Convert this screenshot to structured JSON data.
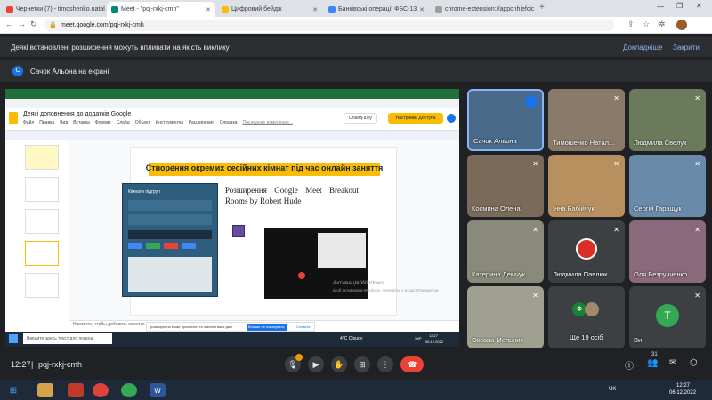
{
  "browser": {
    "tabs": [
      {
        "label": "Чернетки (7) - timoshenko.natal",
        "color": "#ea4335"
      },
      {
        "label": "Meet - \"pqj-rxkj-cmh\"",
        "color": "#00897b"
      },
      {
        "label": "Цифровий бейдж",
        "color": "#fbbc04"
      },
      {
        "label": "Банківські операції ФБС-13",
        "color": "#4285f4"
      },
      {
        "label": "chrome-extension://appcnhiefcic",
        "color": "#9e9e9e"
      }
    ],
    "url": "meet.google.com/pqj-rxkj-cmh"
  },
  "warning": {
    "text": "Деякі встановлені розширення можуть впливати на якість виклику",
    "details": "Докладніше",
    "close": "Закрити"
  },
  "presenter_bar": {
    "initial": "С",
    "text": "Сачок Альона на екрані"
  },
  "shared_screen": {
    "doc_title": "Деякі доповнення до додатків Google",
    "menu": [
      "Файл",
      "Правка",
      "Вид",
      "Вставка",
      "Формат",
      "Слайд",
      "Объект",
      "Инструменты",
      "Расширения",
      "Справка",
      "Последнее изменение..."
    ],
    "slideshow_btn": "Слайд-шоу",
    "access_btn": "Настройки Доступа",
    "slide_heading": "Створення окремих сесійних кімнат під час онлайн заняття",
    "slide_text": "Розширення Google Meet Breakout Rooms by Robert Hude",
    "panel_title": "Кімнати підгруп",
    "notes": "Нажмите, чтобы добавить заметки докладчика",
    "popup_text": "розширення може прочитати та змінити ваші дані",
    "popup_btn": "Більше не показувати",
    "popup_btn2": "Сховати",
    "activation1": "Активація Windows",
    "activation2": "Щоб активувати Windows, перейдіть у розділ Параметри.",
    "search": "Введите здесь текст для поиска",
    "weather": "4°C Cloudy",
    "inner_lang": "УКР",
    "inner_time": "12:27",
    "inner_date": "06.12.2022"
  },
  "participants": [
    {
      "name": "Сачок Альона",
      "bg": "#4a6a8a",
      "speaking": true
    },
    {
      "name": "Тимошенко Натал...",
      "bg": "#8a7a6a"
    },
    {
      "name": "Людмила Свелук",
      "bg": "#6a7a5a"
    },
    {
      "name": "Космина Олена",
      "bg": "#7a6a5a"
    },
    {
      "name": "Інна Бабійчук",
      "bg": "#b89060"
    },
    {
      "name": "Сергій Гаращук",
      "bg": "#6a8aaa"
    },
    {
      "name": "Катерина Демчук",
      "bg": "#8a8a7a"
    },
    {
      "name": "Людмила Павлюк",
      "initial": "",
      "bg": "#3c4043"
    },
    {
      "name": "Оля Безручченко",
      "bg": "#8a6a7a"
    },
    {
      "name": "Оксана Мельник",
      "bg": "#a0a090"
    },
    {
      "name": "Ще 19 осіб",
      "initial": "Ф",
      "bg": "#3c4043"
    },
    {
      "name": "Ви",
      "initial": "Т",
      "bg": "#3c4043"
    }
  ],
  "bottom": {
    "time": "12:27",
    "meeting_id": "pqj-rxkj-cmh",
    "people_count": "31"
  },
  "taskbar": {
    "lang": "UK",
    "time": "12:27",
    "date": "06.12.2022"
  }
}
